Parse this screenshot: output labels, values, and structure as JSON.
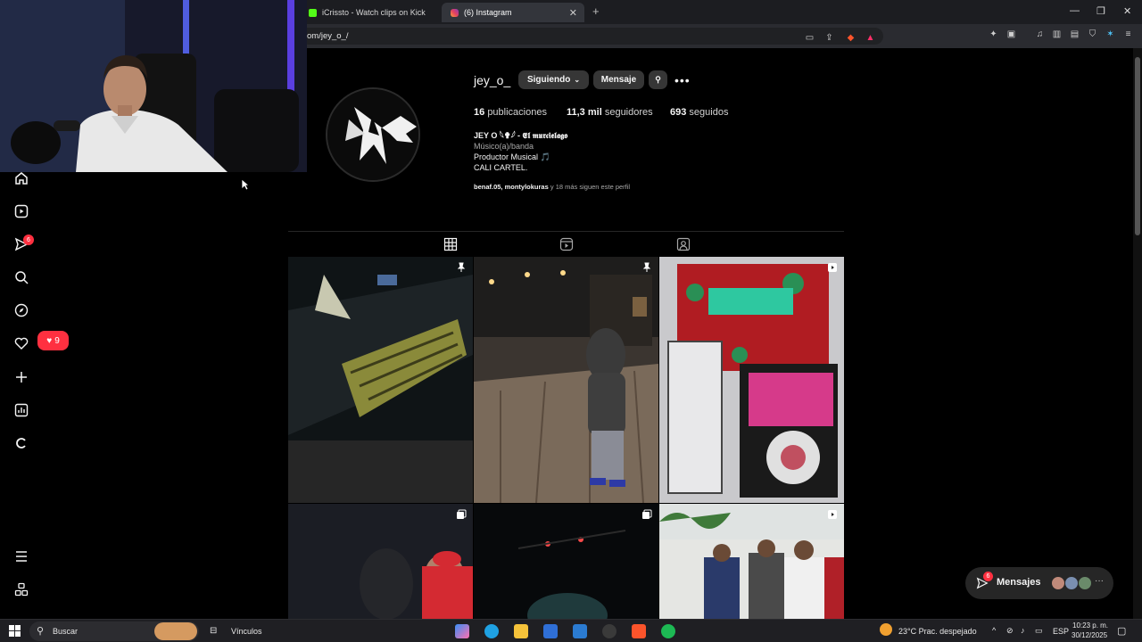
{
  "browser": {
    "tabs": [
      {
        "label": "iCrissto - Watch clips on Kick"
      },
      {
        "label": "(6) Instagram"
      }
    ],
    "url": "om/jey_o_/"
  },
  "sidebar": {
    "notifications_badge": "6",
    "likes_count": "9"
  },
  "profile": {
    "username": "jey_o_",
    "follow_button": "Siguiendo",
    "message_button": "Mensaje",
    "stats": {
      "posts_value": "16",
      "posts_label": "publicaciones",
      "followers_value": "11,3 mil",
      "followers_label": "seguidores",
      "following_value": "693",
      "following_label": "seguidos"
    },
    "bio": {
      "name": "JEY O 𓆩✟𓆪 - 𝕰𝖑 𝖒𝖚𝖗𝖈𝖎𝖊𝖑𝖆𝖌𝖔",
      "category": "Músico(a)/banda",
      "line1": "Productor Musical 🎵",
      "line2": "CALI CARTEL."
    },
    "followed_by": {
      "names": "benaf.05, montylokuras",
      "rest": " y 18 más siguen este perfil"
    }
  },
  "posts": [
    {
      "type": "pinned",
      "alt": "piano-keys-clip"
    },
    {
      "type": "pinned",
      "alt": "hooded-man-walking"
    },
    {
      "type": "reel",
      "alt": "framed-records"
    },
    {
      "type": "carousel",
      "alt": "two-men-studio"
    },
    {
      "type": "carousel",
      "alt": "stage-lights"
    },
    {
      "type": "reel",
      "alt": "group-outdoors"
    }
  ],
  "messages": {
    "label": "Mensajes",
    "badge": "6"
  },
  "taskbar": {
    "search_placeholder": "Buscar",
    "links_label": "Vínculos",
    "weather": "23°C  Prac. despejado",
    "language": "ESP",
    "time": "10:23 p. m.",
    "date": "30/12/2025"
  },
  "colors": {
    "background": "#000000",
    "accent_red": "#ff3040",
    "button_bg": "#363636"
  }
}
